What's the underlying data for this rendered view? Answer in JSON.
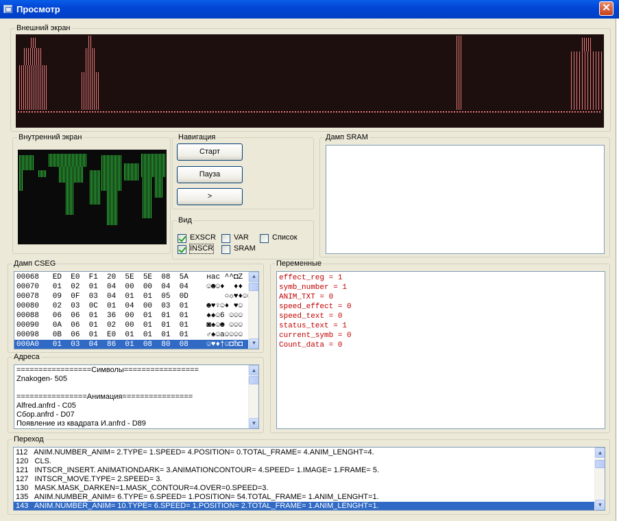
{
  "window": {
    "title": "Просмотр",
    "close_label": "✕"
  },
  "outer_screen": {
    "label": "Внешний экран"
  },
  "inner_screen": {
    "label": "Внутренний экран"
  },
  "navigation": {
    "label": "Навигация",
    "start": "Старт",
    "pause": "Пауза",
    "next": ">"
  },
  "view": {
    "label": "Вид",
    "options": [
      {
        "label": "EXSCR",
        "checked": true
      },
      {
        "label": "VAR",
        "checked": false
      },
      {
        "label": "Список",
        "checked": false
      },
      {
        "label": "INSCR",
        "checked": true
      },
      {
        "label": "SRAM",
        "checked": false
      }
    ]
  },
  "sram_dump": {
    "label": "Дамп SRAM"
  },
  "cseg_dump": {
    "label": "Дамп CSEG",
    "rows": [
      "00068   ED  E0  F1  20  5E  5E  08  5A    нас ^^◘Z",
      "00070   01  02  01  04  00  00  04  04    ☺☻☺♦  ♦♦",
      "00078   09  0F  03  04  01  01  05  0D        ○☼♥♦☺☺♣♪",
      "00080   02  03  0C  01  04  00  03  01    ☻♥♀☺♦ ♥☺",
      "00088   06  06  01  36  00  01  01  01    ♠♠☺6 ☺☺☺",
      "00090   0A  06  01  02  00  01  01  01    ◙♠☺☻ ☺☺☺",
      "00098   0B  06  01  E0  01  01  01  01    ♂♠☺а☺☺☺☺",
      "000A0   01  03  04  86  01  08  80  08    ☺♥♦†☺◘Ђ◘"
    ],
    "selected_index": 7
  },
  "variables": {
    "label": "Переменные",
    "items": [
      "effect_reg = 1",
      "symb_number = 1",
      "ANIM_TXT = 0",
      "speed_effect = 0",
      "speed_text = 0",
      "status_text = 1",
      "current_symb = 0",
      "Count_data = 0"
    ]
  },
  "addresses": {
    "label": "Адреса",
    "rows": [
      "=================Символы=================",
      "Znakogen- 505",
      "",
      "================Анимация================",
      "Alfred.anfrd - C05",
      "Сбор.anfrd - D07",
      "Появление из квадрата И.anfrd - D89"
    ]
  },
  "transition": {
    "label": "Переход",
    "rows": [
      "112   ANIM.NUMBER_ANIM= 2.TYPE= 1.SPEED= 4.POSITION= 0.TOTAL_FRAME= 4.ANIM_LENGHT=4.",
      "120   CLS.",
      "121   INTSCR_INSERT. ANIMATIONDARK= 3.ANIMATIONCONTOUR= 4.SPEED= 1.IMAGE= 1.FRAME= 5.",
      "127   INTSCR_MOVE.TYPE= 2.SPEED= 3.",
      "130   MASK.MASK_DARKEN=1.MASK_CONTOUR=4.OVER=0.SPEED=3.",
      "135   ANIM.NUMBER_ANIM= 6.TYPE= 6.SPEED= 1.POSITION= 54.TOTAL_FRAME= 1.ANIM_LENGHT=1.",
      "143   ANIM.NUMBER_ANIM= 10.TYPE= 6.SPEED= 1.POSITION= 2.TOTAL_FRAME= 1.ANIM_LENGHT=1."
    ],
    "selected_index": 6
  },
  "colors": {
    "outer_dot": "#e87a7a",
    "inner_dot": "#2fbf3a",
    "selection": "#316ac5",
    "variable_text": "#c00000"
  }
}
